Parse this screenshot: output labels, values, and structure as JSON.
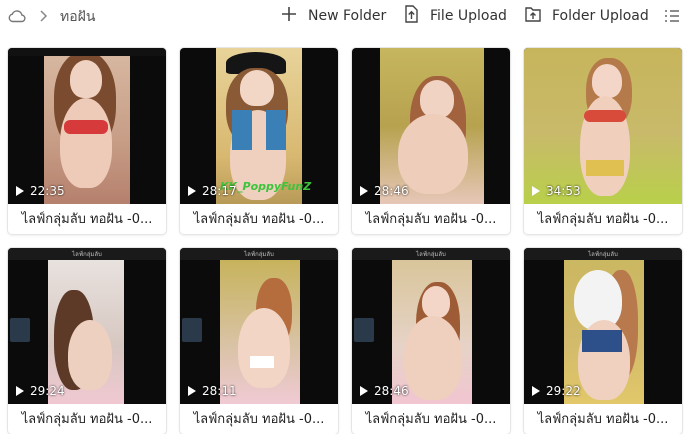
{
  "toolbar": {
    "breadcrumb_current": "ทอฝัน",
    "new_folder_label": "New Folder",
    "file_upload_label": "File Upload",
    "folder_upload_label": "Folder Upload",
    "icons": [
      "cloud-icon",
      "chevron-right-icon",
      "plus-icon",
      "file-upload-icon",
      "folder-upload-icon",
      "list-view-icon"
    ]
  },
  "videos": [
    {
      "duration": "22:35",
      "title": "ไลฟ์กลุ่มลับ ทอฝัน -0..."
    },
    {
      "duration": "28:17",
      "title": "ไลฟ์กลุ่มลับ ทอฝัน -0..."
    },
    {
      "duration": "28:46",
      "title": "ไลฟ์กลุ่มลับ ทอฝัน -0..."
    },
    {
      "duration": "34:53",
      "title": "ไลฟ์กลุ่มลับ ทอฝัน -0..."
    },
    {
      "duration": "29:24",
      "title": "ไลฟ์กลุ่มลับ ทอฝัน -0..."
    },
    {
      "duration": "28:11",
      "title": "ไลฟ์กลุ่มลับ ทอฝัน -0..."
    },
    {
      "duration": "28:46",
      "title": "ไลฟ์กลุ่มลับ ทอฝัน -0..."
    },
    {
      "duration": "29:22",
      "title": "ไลฟ์กลุ่มลับ ทอฝัน -0..."
    }
  ],
  "colors": {
    "accent": "#333333",
    "thumb_bg": "#0b0b0b"
  }
}
